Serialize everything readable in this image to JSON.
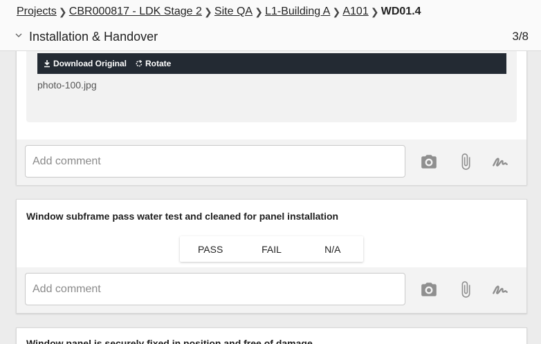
{
  "breadcrumb": {
    "items": [
      "Projects",
      "CBR000817 - LDK Stage 2",
      "Site QA",
      "L1-Building A",
      "A101"
    ],
    "current": "WD01.4"
  },
  "section": {
    "title": "Installation & Handover",
    "counter": "3/8"
  },
  "photo": {
    "download_label": "Download Original",
    "rotate_label": "Rotate",
    "filename": "photo-100.jpg"
  },
  "comments": {
    "placeholder": "Add comment"
  },
  "items": [
    {
      "question": "Window subframe pass water test and cleaned for panel installation",
      "options": [
        "PASS",
        "FAIL",
        "N/A"
      ]
    },
    {
      "question": "Window panel is securely fixed in position and free of damage"
    }
  ],
  "colors": {
    "toolbar_bg": "#232a33",
    "card_bg": "#ffffff",
    "page_bg": "#ececec",
    "icon_gray": "#8f8f8f"
  },
  "icons": [
    "chevron-down-icon",
    "download-icon",
    "rotate-icon",
    "camera-icon",
    "paperclip-icon",
    "signature-icon"
  ]
}
